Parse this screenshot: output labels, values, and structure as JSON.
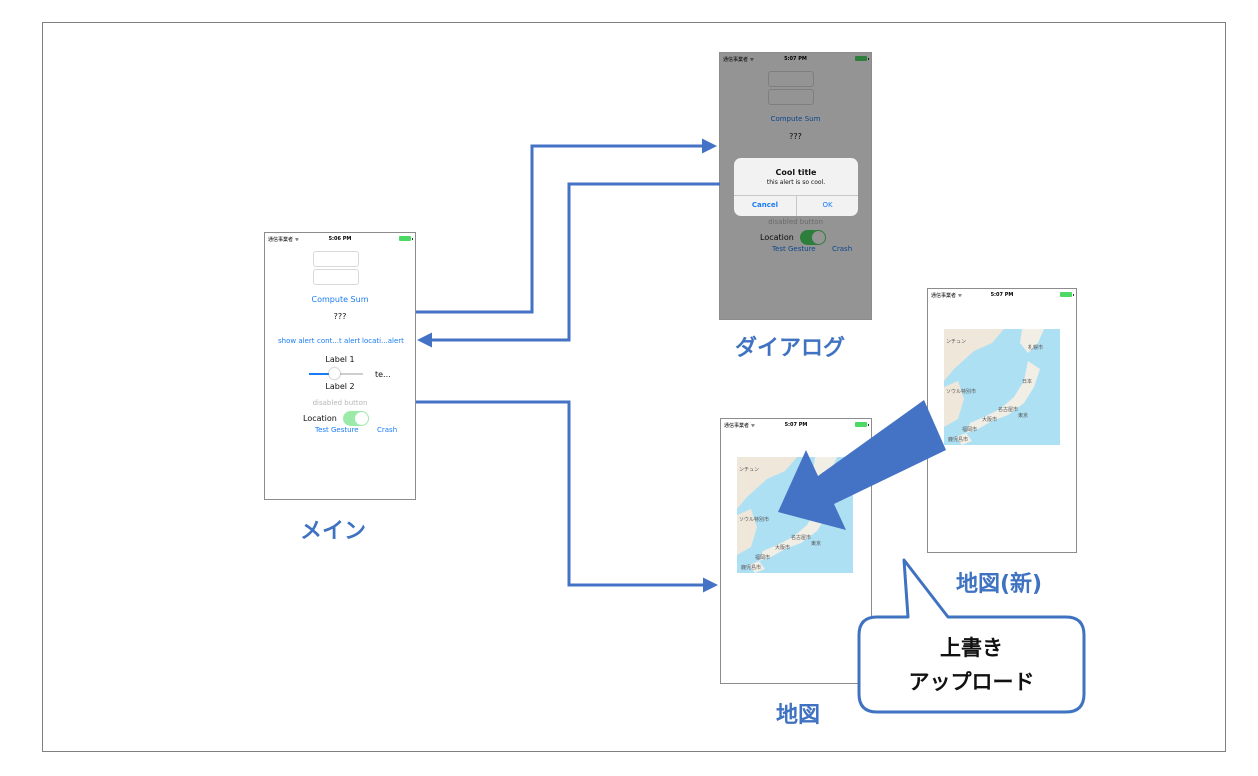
{
  "colors": {
    "arrow": "#4472c4",
    "caption": "#3f72c0",
    "link": "#1a7cf5"
  },
  "main": {
    "caption": "メイン",
    "status": {
      "carrier": "通信事業者 ᯤ",
      "time": "5:06 PM"
    },
    "compute_sum": "Compute Sum",
    "result": "???",
    "buttons": [
      "show alert",
      "cont...t alert",
      "locati...alert"
    ],
    "label1": "Label 1",
    "slider_value_label": "te...",
    "label2": "Label 2",
    "disabled_button": "disabled button",
    "location_label": "Location",
    "test_gesture": "Test Gesture",
    "crash": "Crash"
  },
  "dialog": {
    "caption": "ダイアログ",
    "status": {
      "carrier": "通信事業者 ᯤ",
      "time": "5:07 PM"
    },
    "compute_sum": "Compute Sum",
    "result": "???",
    "alert_title": "Cool title",
    "alert_message": "this alert is so cool.",
    "cancel": "Cancel",
    "ok": "OK",
    "disabled_button": "disabled button",
    "location_label": "Location",
    "test_gesture": "Test Gesture",
    "crash": "Crash"
  },
  "map_screen": {
    "caption": "地図",
    "status": {
      "carrier": "通信事業者 ᯤ",
      "time": "5:07 PM"
    }
  },
  "map_new_screen": {
    "caption": "地図(新)",
    "status": {
      "carrier": "通信事業者 ᯤ",
      "time": "5:07 PM"
    }
  },
  "map_labels": [
    "ンチュン",
    "札幌市",
    "ソウル特別市",
    "日本",
    "名古屋市",
    "大阪市",
    "東京",
    "福岡市",
    "鹿児島市"
  ],
  "callout": {
    "line1": "上書き",
    "line2": "アップロード"
  }
}
